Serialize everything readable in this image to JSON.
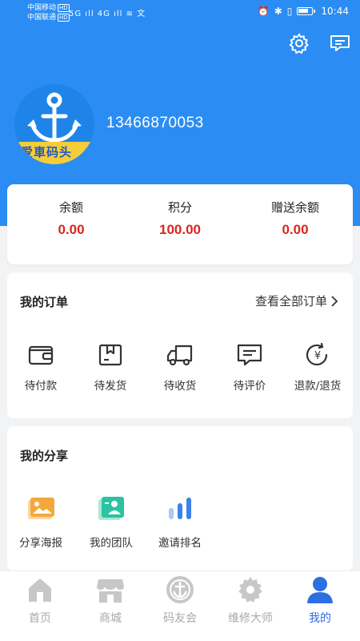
{
  "status_bar": {
    "carrier1": "中国移动",
    "carrier2": "中国联通",
    "hd": "HD",
    "signal": "5G ıll 4G ıll ≋ 文",
    "time": "10:44"
  },
  "profile": {
    "phone": "13466870053",
    "avatar_text": "爱車码头"
  },
  "balances": [
    {
      "label": "余额",
      "value": "0.00"
    },
    {
      "label": "积分",
      "value": "100.00"
    },
    {
      "label": "赠送余额",
      "value": "0.00"
    }
  ],
  "orders": {
    "title": "我的订单",
    "view_all": "查看全部订单",
    "items": [
      {
        "label": "待付款",
        "icon": "wallet-icon"
      },
      {
        "label": "待发货",
        "icon": "package-icon"
      },
      {
        "label": "待收货",
        "icon": "truck-icon"
      },
      {
        "label": "待评价",
        "icon": "comment-icon"
      },
      {
        "label": "退款/退货",
        "icon": "refund-icon"
      }
    ]
  },
  "shares": {
    "title": "我的分享",
    "items": [
      {
        "label": "分享海报",
        "icon": "poster-icon"
      },
      {
        "label": "我的团队",
        "icon": "team-icon"
      },
      {
        "label": "邀请排名",
        "icon": "ranking-icon"
      }
    ]
  },
  "tabs": [
    {
      "label": "首页",
      "icon": "home-icon",
      "active": false
    },
    {
      "label": "商城",
      "icon": "store-icon",
      "active": false
    },
    {
      "label": "码友会",
      "icon": "club-icon",
      "active": false
    },
    {
      "label": "维修大师",
      "icon": "gear-icon",
      "active": false
    },
    {
      "label": "我的",
      "icon": "user-icon",
      "active": true
    }
  ],
  "colors": {
    "primary": "#2b8df3",
    "value_red": "#d9261c",
    "tab_active": "#2b6fe0",
    "tab_inactive": "#aaaaaa"
  }
}
